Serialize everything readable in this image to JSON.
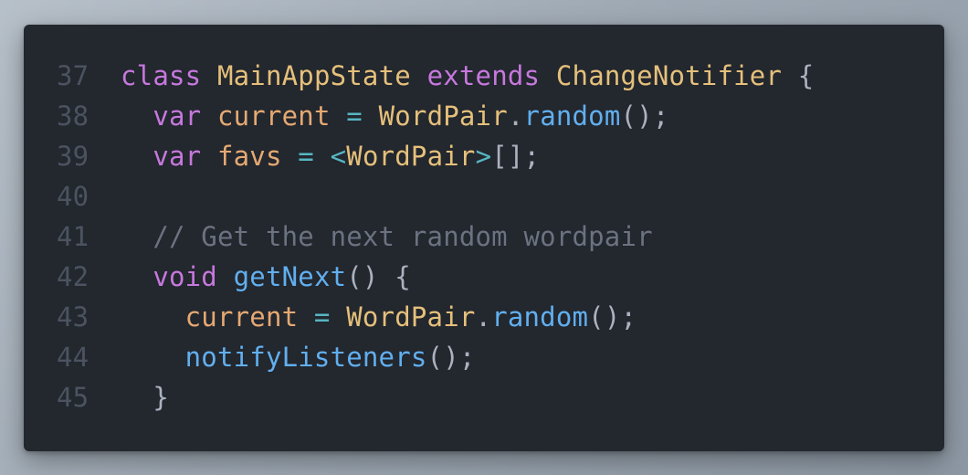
{
  "editor": {
    "lines": [
      {
        "number": "37",
        "tokens": [
          {
            "text": "class",
            "type": "kw"
          },
          {
            "text": " ",
            "type": "pun"
          },
          {
            "text": "MainAppState",
            "type": "cls"
          },
          {
            "text": " ",
            "type": "pun"
          },
          {
            "text": "extends",
            "type": "kw"
          },
          {
            "text": " ",
            "type": "pun"
          },
          {
            "text": "ChangeNotifier",
            "type": "cls"
          },
          {
            "text": " {",
            "type": "pun"
          }
        ]
      },
      {
        "number": "38",
        "tokens": [
          {
            "text": "  ",
            "type": "pun"
          },
          {
            "text": "var",
            "type": "kw"
          },
          {
            "text": " ",
            "type": "pun"
          },
          {
            "text": "current",
            "type": "var"
          },
          {
            "text": " = ",
            "type": "op"
          },
          {
            "text": "WordPair",
            "type": "cls"
          },
          {
            "text": ".",
            "type": "pun"
          },
          {
            "text": "random",
            "type": "fn"
          },
          {
            "text": "();",
            "type": "pun"
          }
        ]
      },
      {
        "number": "39",
        "tokens": [
          {
            "text": "  ",
            "type": "pun"
          },
          {
            "text": "var",
            "type": "kw"
          },
          {
            "text": " ",
            "type": "pun"
          },
          {
            "text": "favs",
            "type": "var"
          },
          {
            "text": " = ",
            "type": "op"
          },
          {
            "text": "<",
            "type": "op"
          },
          {
            "text": "WordPair",
            "type": "cls"
          },
          {
            "text": ">",
            "type": "op"
          },
          {
            "text": "[];",
            "type": "pun"
          }
        ]
      },
      {
        "number": "40",
        "tokens": []
      },
      {
        "number": "41",
        "tokens": [
          {
            "text": "  ",
            "type": "pun"
          },
          {
            "text": "// Get the next random wordpair",
            "type": "cm"
          }
        ]
      },
      {
        "number": "42",
        "tokens": [
          {
            "text": "  ",
            "type": "pun"
          },
          {
            "text": "void",
            "type": "kw"
          },
          {
            "text": " ",
            "type": "pun"
          },
          {
            "text": "getNext",
            "type": "fn"
          },
          {
            "text": "() {",
            "type": "pun"
          }
        ]
      },
      {
        "number": "43",
        "tokens": [
          {
            "text": "    ",
            "type": "pun"
          },
          {
            "text": "current",
            "type": "var"
          },
          {
            "text": " = ",
            "type": "op"
          },
          {
            "text": "WordPair",
            "type": "cls"
          },
          {
            "text": ".",
            "type": "pun"
          },
          {
            "text": "random",
            "type": "fn"
          },
          {
            "text": "();",
            "type": "pun"
          }
        ]
      },
      {
        "number": "44",
        "tokens": [
          {
            "text": "    ",
            "type": "pun"
          },
          {
            "text": "notifyListeners",
            "type": "fn"
          },
          {
            "text": "();",
            "type": "pun"
          }
        ]
      },
      {
        "number": "45",
        "tokens": [
          {
            "text": "  ",
            "type": "pun"
          },
          {
            "text": "}",
            "type": "pun"
          }
        ]
      }
    ]
  },
  "colors": {
    "background": "#23272e",
    "line_number": "#4b5360",
    "keyword": "#c678dd",
    "class_name": "#e5c07b",
    "variable": "#e5a972",
    "function": "#61afef",
    "operator": "#56b6c2",
    "punctuation": "#abb2bf",
    "comment": "#6b7280"
  }
}
